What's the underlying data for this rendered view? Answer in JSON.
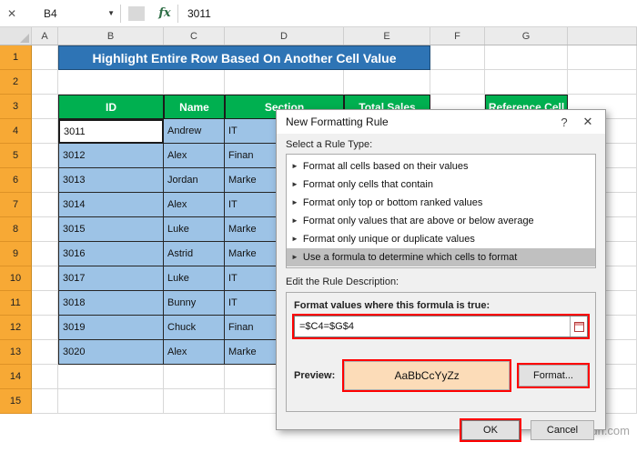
{
  "icons": {
    "window_close": "✕",
    "name_dropdown": "▼",
    "rule_marker": "►"
  },
  "formula_bar": {
    "name_box": "B4",
    "fx_label": "fx",
    "formula": "3011"
  },
  "grid": {
    "column_headers": [
      "A",
      "B",
      "C",
      "D",
      "E",
      "F",
      "G"
    ],
    "row_headers": [
      "1",
      "2",
      "3",
      "4",
      "5",
      "6",
      "7",
      "8",
      "9",
      "10",
      "11",
      "12",
      "13",
      "14",
      "15"
    ]
  },
  "sheet": {
    "banner": "Highlight Entire Row Based On Another Cell Value",
    "headers": {
      "id": "ID",
      "name": "Name",
      "section": "Section",
      "total_sales": "Total Sales",
      "reference": "Reference Cell"
    },
    "rows": [
      {
        "id": "3011",
        "name": "Andrew",
        "section": "IT"
      },
      {
        "id": "3012",
        "name": "Alex",
        "section": "Finan"
      },
      {
        "id": "3013",
        "name": "Jordan",
        "section": "Marke"
      },
      {
        "id": "3014",
        "name": "Alex",
        "section": "IT"
      },
      {
        "id": "3015",
        "name": "Luke",
        "section": "Marke"
      },
      {
        "id": "3016",
        "name": "Astrid",
        "section": "Marke"
      },
      {
        "id": "3017",
        "name": "Luke",
        "section": "IT"
      },
      {
        "id": "3018",
        "name": "Bunny",
        "section": "IT"
      },
      {
        "id": "3019",
        "name": "Chuck",
        "section": "Finan"
      },
      {
        "id": "3020",
        "name": "Alex",
        "section": "Marke"
      }
    ]
  },
  "dialog": {
    "title": "New Formatting Rule",
    "help_label": "?",
    "close_label": "✕",
    "select_rule_label": "Select a Rule Type:",
    "rule_types": [
      "Format all cells based on their values",
      "Format only cells that contain",
      "Format only top or bottom ranked values",
      "Format only values that are above or below average",
      "Format only unique or duplicate values",
      "Use a formula to determine which cells to format"
    ],
    "selected_rule_index": 5,
    "edit_rule_label": "Edit the Rule Description:",
    "formula_label": "Format values where this formula is true:",
    "formula_value": "=$C4=$G$4",
    "preview_label": "Preview:",
    "preview_sample": "AaBbCcYyZz",
    "format_button": "Format...",
    "ok_button": "OK",
    "cancel_button": "Cancel"
  },
  "watermark": "wsxdn.com",
  "colors": {
    "banner_bg": "#2E74B5",
    "table_header_bg": "#00B050",
    "cell_bg": "#9DC3E6",
    "row_header_bg": "#F7A935",
    "preview_bg": "#FCDCB8",
    "annotation": "#FF0000"
  }
}
